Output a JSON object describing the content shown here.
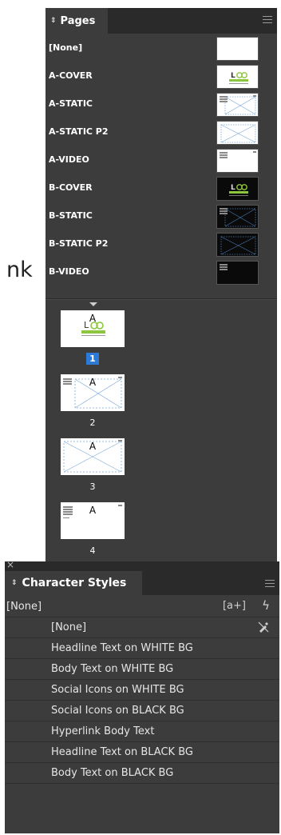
{
  "background": {
    "partial_word": "nk"
  },
  "pages_panel": {
    "tab_label": "Pages",
    "masters": [
      {
        "label": "[None]",
        "thumb": "blank"
      },
      {
        "label": "A-COVER",
        "thumb": "logo-light"
      },
      {
        "label": "A-STATIC",
        "thumb": "static-light"
      },
      {
        "label": "A-STATIC P2",
        "thumb": "cross-light"
      },
      {
        "label": "A-VIDEO",
        "thumb": "video-light"
      },
      {
        "label": "B-COVER",
        "thumb": "logo-dark"
      },
      {
        "label": "B-STATIC",
        "thumb": "static-dark"
      },
      {
        "label": "B-STATIC P2",
        "thumb": "cross-dark"
      },
      {
        "label": "B-VIDEO",
        "thumb": "video-dark"
      }
    ],
    "pages": [
      {
        "number": "1",
        "master_prefix": "A",
        "selected": true
      },
      {
        "number": "2",
        "master_prefix": "A",
        "selected": false
      },
      {
        "number": "3",
        "master_prefix": "A",
        "selected": false
      },
      {
        "number": "4",
        "master_prefix": "A",
        "selected": false
      }
    ]
  },
  "character_styles_panel": {
    "tab_label": "Character Styles",
    "current_style": "[None]",
    "styles": [
      "[None]",
      "Headline Text on WHITE BG",
      "Body Text on WHITE BG",
      "Social Icons on WHITE BG",
      "Social Icons on BLACK BG",
      "Hyperlink Body Text",
      "Headline Text on BLACK BG",
      "Body Text on BLACK BG"
    ],
    "icons": {
      "new_group": "new-style-group-icon",
      "quick_apply": "quick-apply-lightning-icon",
      "clear_override": "clear-overrides-icon",
      "close": "close-icon"
    }
  },
  "colors": {
    "panel_bg": "#3c3c3c",
    "tabbar_bg": "#2a2a2a",
    "selection_blue": "#2d79d6",
    "logo_green": "#8cc63f"
  }
}
